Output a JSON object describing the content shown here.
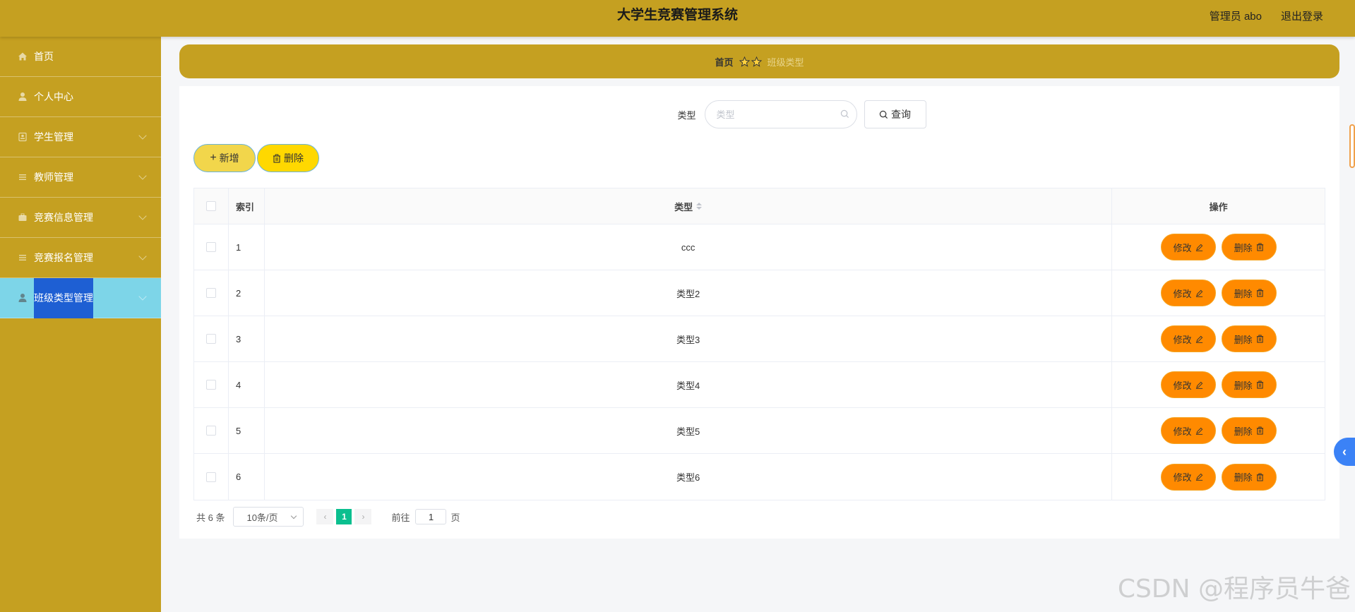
{
  "header": {
    "title": "大学生竞赛管理系统",
    "user": "管理员 abo",
    "logout": "退出登录"
  },
  "sidebar": {
    "items": [
      {
        "label": "首页",
        "icon": "home-icon"
      },
      {
        "label": "个人中心",
        "icon": "user-icon"
      },
      {
        "label": "学生管理",
        "icon": "student-icon"
      },
      {
        "label": "教师管理",
        "icon": "list-icon"
      },
      {
        "label": "竞赛信息管理",
        "icon": "briefcase-icon"
      },
      {
        "label": "竞赛报名管理",
        "icon": "list-icon"
      },
      {
        "label": "班级类型管理",
        "icon": "user-icon",
        "active": true
      }
    ]
  },
  "breadcrumb": {
    "home": "首页",
    "current": "班级类型"
  },
  "search": {
    "label": "类型",
    "placeholder": "类型",
    "button": "查询"
  },
  "actions": {
    "add": "新增",
    "delete": "删除"
  },
  "table": {
    "headers": {
      "index": "索引",
      "type": "类型",
      "ops": "操作"
    },
    "rows": [
      {
        "index": "1",
        "type": "ccc"
      },
      {
        "index": "2",
        "type": "类型2"
      },
      {
        "index": "3",
        "type": "类型3"
      },
      {
        "index": "4",
        "type": "类型4"
      },
      {
        "index": "5",
        "type": "类型5"
      },
      {
        "index": "6",
        "type": "类型6"
      }
    ],
    "edit_label": "修改",
    "delete_label": "删除"
  },
  "pagination": {
    "total": "共 6 条",
    "page_size": "10条/页",
    "current_page": "1",
    "goto_label": "前往",
    "goto_value": "1",
    "page_suffix": "页"
  },
  "watermark": "CSDN @程序员牛爸",
  "colors": {
    "header": "#c5a021",
    "sidebar": "#c5a021",
    "active_item": "#7dd5e8",
    "op_button": "#ff8a00",
    "pager_active": "#0bbf8f"
  }
}
